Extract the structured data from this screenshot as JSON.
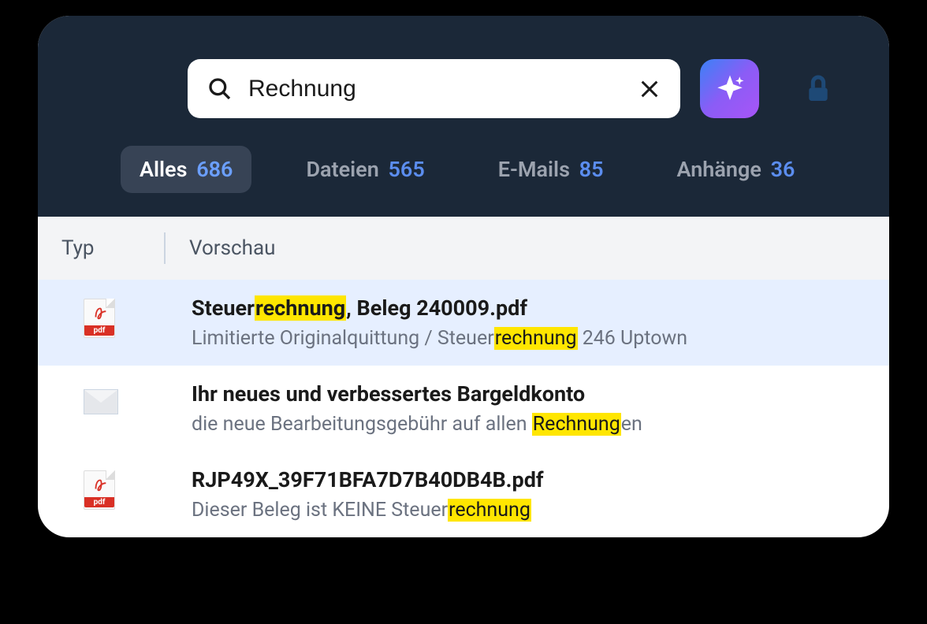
{
  "search": {
    "value": "Rechnung"
  },
  "tabs": {
    "all": {
      "label": "Alles",
      "count": "686"
    },
    "files": {
      "label": "Dateien",
      "count": "565"
    },
    "emails": {
      "label": "E-Mails",
      "count": "85"
    },
    "attachments": {
      "label": "Anhänge",
      "count": "36"
    }
  },
  "columns": {
    "type": "Typ",
    "preview": "Vorschau"
  },
  "results": [
    {
      "icon": "pdf",
      "title_parts": [
        "Steuer",
        "rechnung",
        ", Beleg 240009.pdf"
      ],
      "snippet_parts": [
        "Limitierte Originalquittung / Steuer",
        "rechnung",
        " 246 Uptown"
      ]
    },
    {
      "icon": "mail",
      "title_parts": [
        "Ihr neues und verbessertes Bargeldkonto"
      ],
      "snippet_parts": [
        "die neue Bearbeitungsgebühr auf allen ",
        "Rechnung",
        "en"
      ]
    },
    {
      "icon": "pdf",
      "title_parts": [
        "RJP49X_39F71BFA7D7B40DB4B.pdf"
      ],
      "snippet_parts": [
        "Dieser Beleg ist KEINE Steuer",
        "rechnung"
      ]
    }
  ]
}
